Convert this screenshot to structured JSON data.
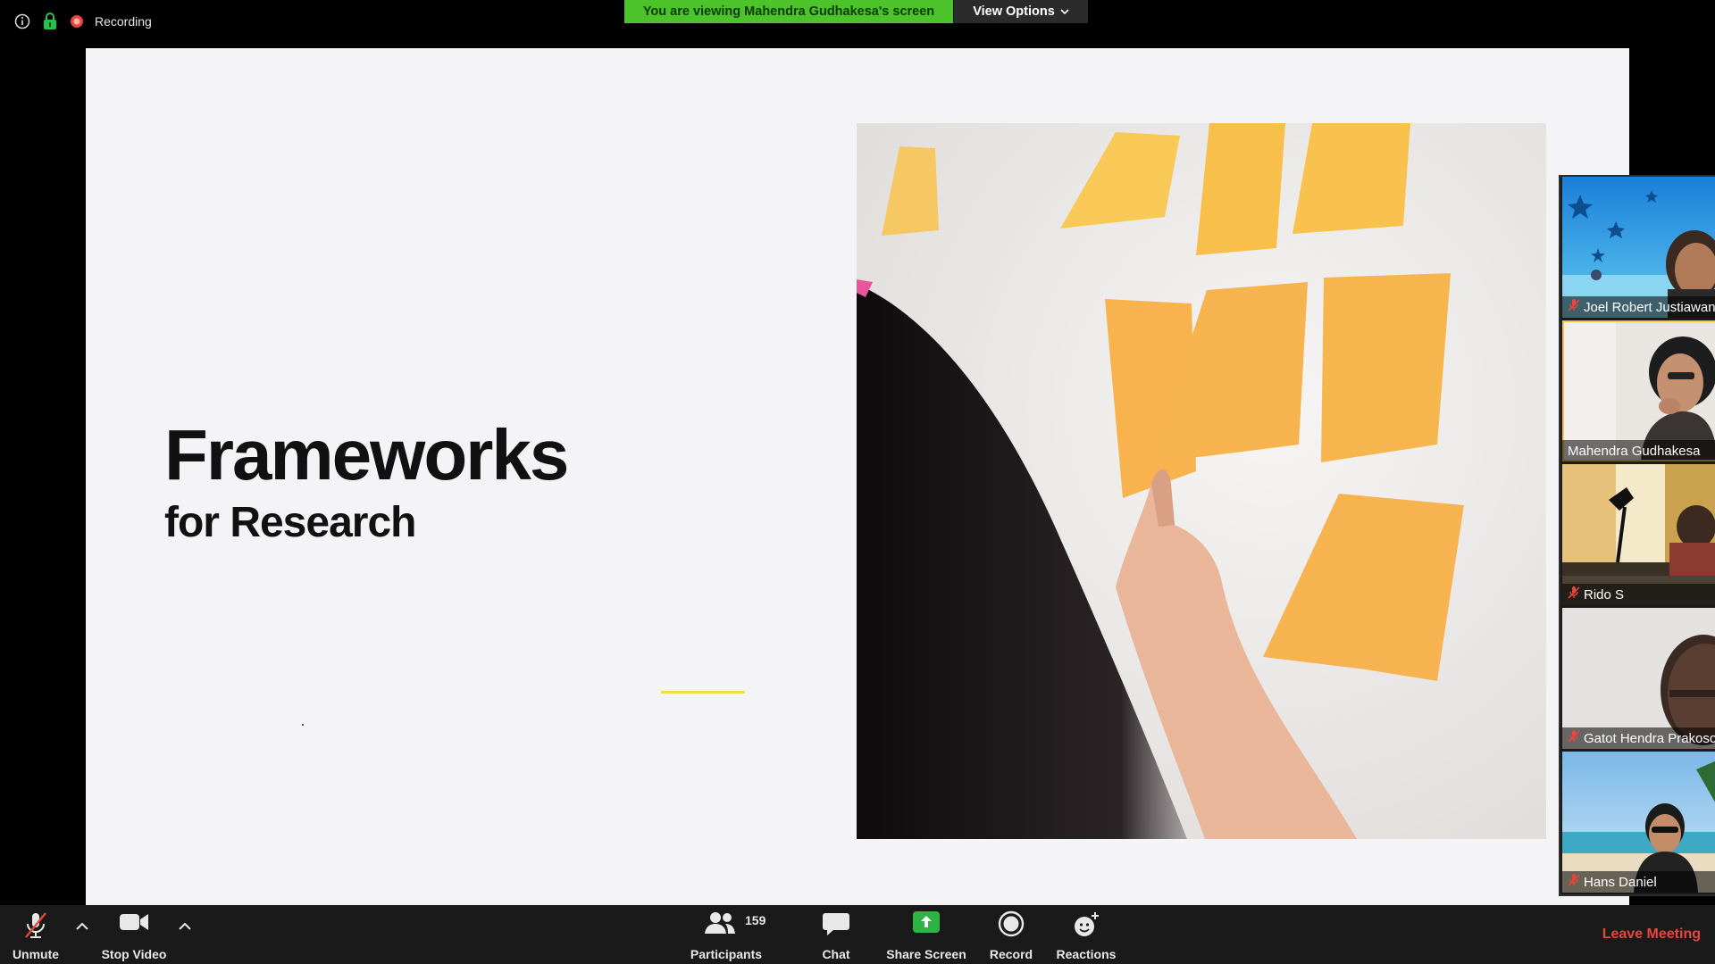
{
  "topbar": {
    "recording_label": "Recording",
    "banner_text": "You are viewing Mahendra Gudhakesa's screen",
    "view_options_label": "View Options"
  },
  "slide": {
    "title": "Frameworks",
    "subtitle": "for Research"
  },
  "gallery": {
    "participants": [
      {
        "name": "Joel Robert Justiawan",
        "muted": true,
        "active": false
      },
      {
        "name": "Mahendra Gudhakesa",
        "muted": false,
        "active": true
      },
      {
        "name": "Rido S",
        "muted": true,
        "active": false
      },
      {
        "name": "Gatot Hendra Prakoso",
        "muted": true,
        "active": false
      },
      {
        "name": "Hans Daniel",
        "muted": true,
        "active": false
      }
    ]
  },
  "toolbar": {
    "unmute_label": "Unmute",
    "stop_video_label": "Stop Video",
    "participants_label": "Participants",
    "participants_count": "159",
    "chat_label": "Chat",
    "share_screen_label": "Share Screen",
    "record_label": "Record",
    "reactions_label": "Reactions",
    "leave_label": "Leave Meeting"
  },
  "colors": {
    "banner_green": "#4cc22b",
    "share_green": "#2fb344",
    "leave_red": "#e8453c",
    "active_speaker": "#f4c542"
  }
}
